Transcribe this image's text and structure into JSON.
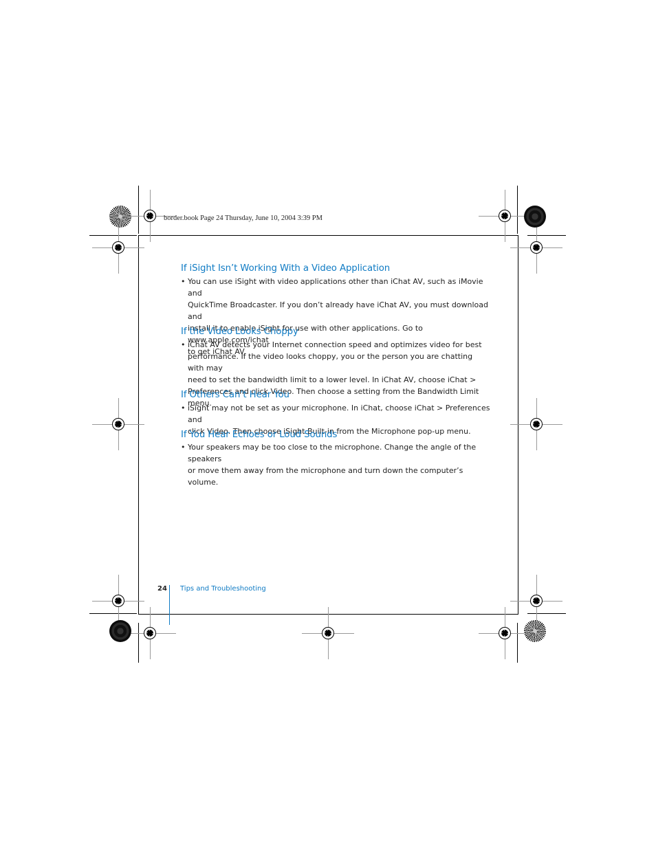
{
  "slug": "border.book  Page 24  Thursday, June 10, 2004  3:39 PM",
  "sections": [
    {
      "heading": "If iSight Isn’t Working With a Video Application",
      "bullet": "•",
      "lines": [
        "You can use iSight with video applications other than iChat AV, such as iMovie and",
        "QuickTime Broadcaster. If you don’t already have iChat AV, you must download and",
        "install it to enable iSight for use with other applications. Go to www.apple.com/ichat",
        "to get iChat AV."
      ]
    },
    {
      "heading": "If the Video Looks Choppy",
      "bullet": "•",
      "lines": [
        "iChat AV detects your Internet connection speed and optimizes video for best",
        "performance. If the video looks choppy, you or the person you are chatting with may",
        "need to set the bandwidth limit to a lower level. In iChat AV, choose iChat >",
        "Preferences and click Video. Then choose a setting from the Bandwidth Limit menu."
      ]
    },
    {
      "heading": "If Others Can’t Hear You",
      "bullet": "•",
      "lines": [
        "iSight may not be set as your microphone. In iChat, choose iChat > Preferences and",
        "click Video. Then choose iSight Built-in from the Microphone pop-up menu."
      ]
    },
    {
      "heading": "If You Hear Echoes or Loud Sounds",
      "bullet": "•",
      "lines": [
        "Your speakers may be too close to the microphone. Change the angle of the speakers",
        "or move them away from the microphone and turn down the computer’s volume."
      ]
    }
  ],
  "footer": {
    "page_number": "24",
    "chapter_title": "Tips and Troubleshooting"
  },
  "colors": {
    "accent": "#0f7bc4",
    "text": "#222222"
  }
}
